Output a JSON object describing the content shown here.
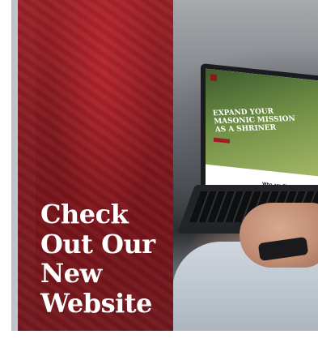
{
  "headline": {
    "lines": [
      "Check",
      "Out Our",
      "New",
      "Website"
    ]
  },
  "laptop_site": {
    "headline": "Expand your Masonic mission as a Shriner",
    "section_heading": "Who are Shriners?"
  },
  "colors": {
    "brand_red": "#8b1a1a",
    "panel_red": "#9a1b22",
    "text_white": "#ffffff"
  }
}
